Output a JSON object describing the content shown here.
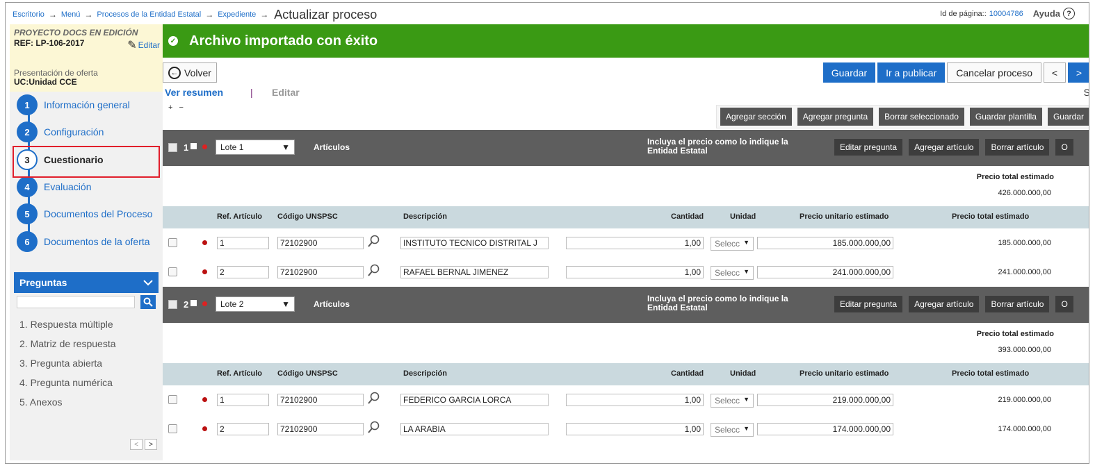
{
  "breadcrumb": {
    "items": [
      "Escritorio",
      "Menú",
      "Procesos de la Entidad Estatal",
      "Expediente"
    ],
    "current": "Actualizar proceso"
  },
  "page_id": {
    "label": "Id de página::",
    "value": "10004786"
  },
  "help_label": "Ayuda",
  "project": {
    "name": "PROYECTO DOCS EN EDICIÓN",
    "ref": "REF: LP-106-2017",
    "edit_label": "Editar",
    "stage": "Presentación de oferta",
    "uc": "UC:Unidad CCE"
  },
  "steps": [
    {
      "num": "1",
      "label": "Información general"
    },
    {
      "num": "2",
      "label": "Configuración"
    },
    {
      "num": "3",
      "label": "Cuestionario"
    },
    {
      "num": "4",
      "label": "Evaluación"
    },
    {
      "num": "5",
      "label": "Documentos del Proceso"
    },
    {
      "num": "6",
      "label": "Documentos de la oferta"
    }
  ],
  "preguntas": {
    "title": "Preguntas",
    "items": [
      "1. Respuesta múltiple",
      "2. Matriz de respuesta",
      "3. Pregunta abierta",
      "4. Pregunta numérica",
      "5. Anexos"
    ],
    "prev": "<",
    "next": ">"
  },
  "banner": "Archivo importado con éxito",
  "toolbar": {
    "volver": "Volver",
    "guardar": "Guardar",
    "publicar": "Ir a publicar",
    "cancelar": "Cancelar proceso",
    "prev": "<",
    "next": ">"
  },
  "tabs": {
    "resumen": "Ver resumen",
    "sep": "|",
    "editar": "Editar",
    "right": "S"
  },
  "expand": "+ −",
  "section_buttons": [
    "Agregar sección",
    "Agregar pregunta",
    "Borrar seleccionado",
    "Guardar plantilla",
    "Guardar"
  ],
  "lote_buttons": [
    "Editar pregunta",
    "Agregar artículo",
    "Borrar artículo",
    "O"
  ],
  "columns": {
    "ref": "Ref. Artículo",
    "unspsc": "Código UNSPSC",
    "desc": "Descripción",
    "cantidad": "Cantidad",
    "unidad": "Unidad",
    "unitario": "Precio unitario estimado",
    "total": "Precio total estimado"
  },
  "lotes": [
    {
      "num": "1",
      "select": "Lote 1",
      "articulos": "Artículos",
      "note": "Incluya el precio como lo indique la Entidad Estatal",
      "total_label": "Precio total estimado",
      "total_value": "426.000.000,00",
      "rows": [
        {
          "ref": "1",
          "code": "72102900",
          "desc": "INSTITUTO TECNICO DISTRITAL J",
          "qty": "1,00",
          "unit": "Selecc",
          "unit_price": "185.000.000,00",
          "total": "185.000.000,00"
        },
        {
          "ref": "2",
          "code": "72102900",
          "desc": "RAFAEL BERNAL JIMENEZ",
          "qty": "1,00",
          "unit": "Selecc",
          "unit_price": "241.000.000,00",
          "total": "241.000.000,00"
        }
      ]
    },
    {
      "num": "2",
      "select": "Lote 2",
      "articulos": "Artículos",
      "note": "Incluya el precio como lo indique la Entidad Estatal",
      "total_label": "Precio total estimado",
      "total_value": "393.000.000,00",
      "rows": [
        {
          "ref": "1",
          "code": "72102900",
          "desc": "FEDERICO GARCIA LORCA",
          "qty": "1,00",
          "unit": "Selecc",
          "unit_price": "219.000.000,00",
          "total": "219.000.000,00"
        },
        {
          "ref": "2",
          "code": "72102900",
          "desc": "LA ARABIA",
          "qty": "1,00",
          "unit": "Selecc",
          "unit_price": "174.000.000,00",
          "total": "174.000.000,00"
        }
      ]
    }
  ],
  "colors": {
    "primary": "#1e6ec8",
    "success": "#3a9a14",
    "highlight": "#e11e2b",
    "lote_bar": "#5e5e5e",
    "table_head": "#cad9de"
  }
}
